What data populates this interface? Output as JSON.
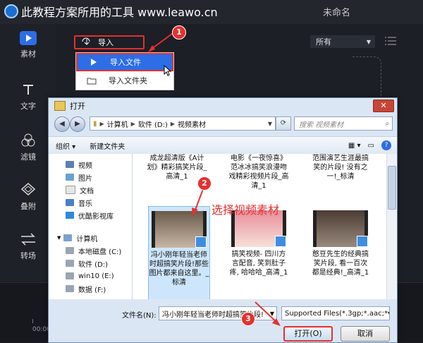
{
  "app": {
    "watermark_text": "此教程方案所用的工具 www.leawo.cn",
    "project_name": "未命名",
    "accent_color": "#2d6de6",
    "annotation_color": "#e53030"
  },
  "sidebar": {
    "items": [
      {
        "label": "素材",
        "icon": "play-icon"
      },
      {
        "label": "文字",
        "icon": "text-icon"
      },
      {
        "label": "滤镜",
        "icon": "filter-icon"
      },
      {
        "label": "叠附",
        "icon": "overlay-icon"
      },
      {
        "label": "转场",
        "icon": "transition-icon"
      }
    ]
  },
  "media": {
    "import_label": "导入",
    "filter_value": "所有",
    "menu": [
      {
        "label": "导入文件",
        "icon": "play-icon"
      },
      {
        "label": "导入文件夹",
        "icon": "folder-icon"
      }
    ]
  },
  "timeline": {
    "time": "00:00"
  },
  "dialog": {
    "title": "打开",
    "close_label": "✕",
    "address": [
      "计算机",
      "软件 (D:)",
      "视频素材"
    ],
    "search_placeholder": "搜索 视频素材",
    "toolbar": {
      "organize": "组织 ▾",
      "new_folder": "新建文件夹"
    },
    "nav_items": [
      {
        "label": "视频",
        "group": "lib"
      },
      {
        "label": "图片",
        "group": "lib"
      },
      {
        "label": "文档",
        "group": "lib"
      },
      {
        "label": "音乐",
        "group": "lib"
      },
      {
        "label": "优酷影视库",
        "group": "lib"
      },
      {
        "label": "计算机",
        "group": "root"
      },
      {
        "label": "本地磁盘 (C:)",
        "group": "drive"
      },
      {
        "label": "软件 (D:)",
        "group": "drive"
      },
      {
        "label": "win10 (E:)",
        "group": "drive"
      },
      {
        "label": "数据 (F:)",
        "group": "drive"
      }
    ],
    "files_top": [
      {
        "name": "成龙超清版《A计划》精彩搞笑片段_高清_1"
      },
      {
        "name": "电影《一夜惊喜》范冰冰搞笑浪漫吻戏精彩视频片段_高清_1"
      },
      {
        "name": "范围演艺生涯最搞笑的片段! 没有之一!_标清"
      }
    ],
    "files_bottom": [
      {
        "name": "冯小刚年轻当老师时超搞笑片段!那些图片都来自这里。_标清",
        "selected": true
      },
      {
        "name": "搞笑视频- 四川方言配音, 笑到肚子疼, 哈哈哈_高清_1",
        "selected": false
      },
      {
        "name": "憨豆先生的经典搞笑片段, 看一百次都是经典!_高清_1",
        "selected": false
      }
    ],
    "callout": "选择视频素材",
    "filename_label": "文件名(N):",
    "filename_value": "冯小刚年轻当老师时超搞笑片段!",
    "filetype_value": "Supported Files(*.3gp;*.aac;*",
    "open_label": "打开(O)",
    "cancel_label": "取消"
  },
  "steps": [
    "1",
    "2",
    "3"
  ]
}
